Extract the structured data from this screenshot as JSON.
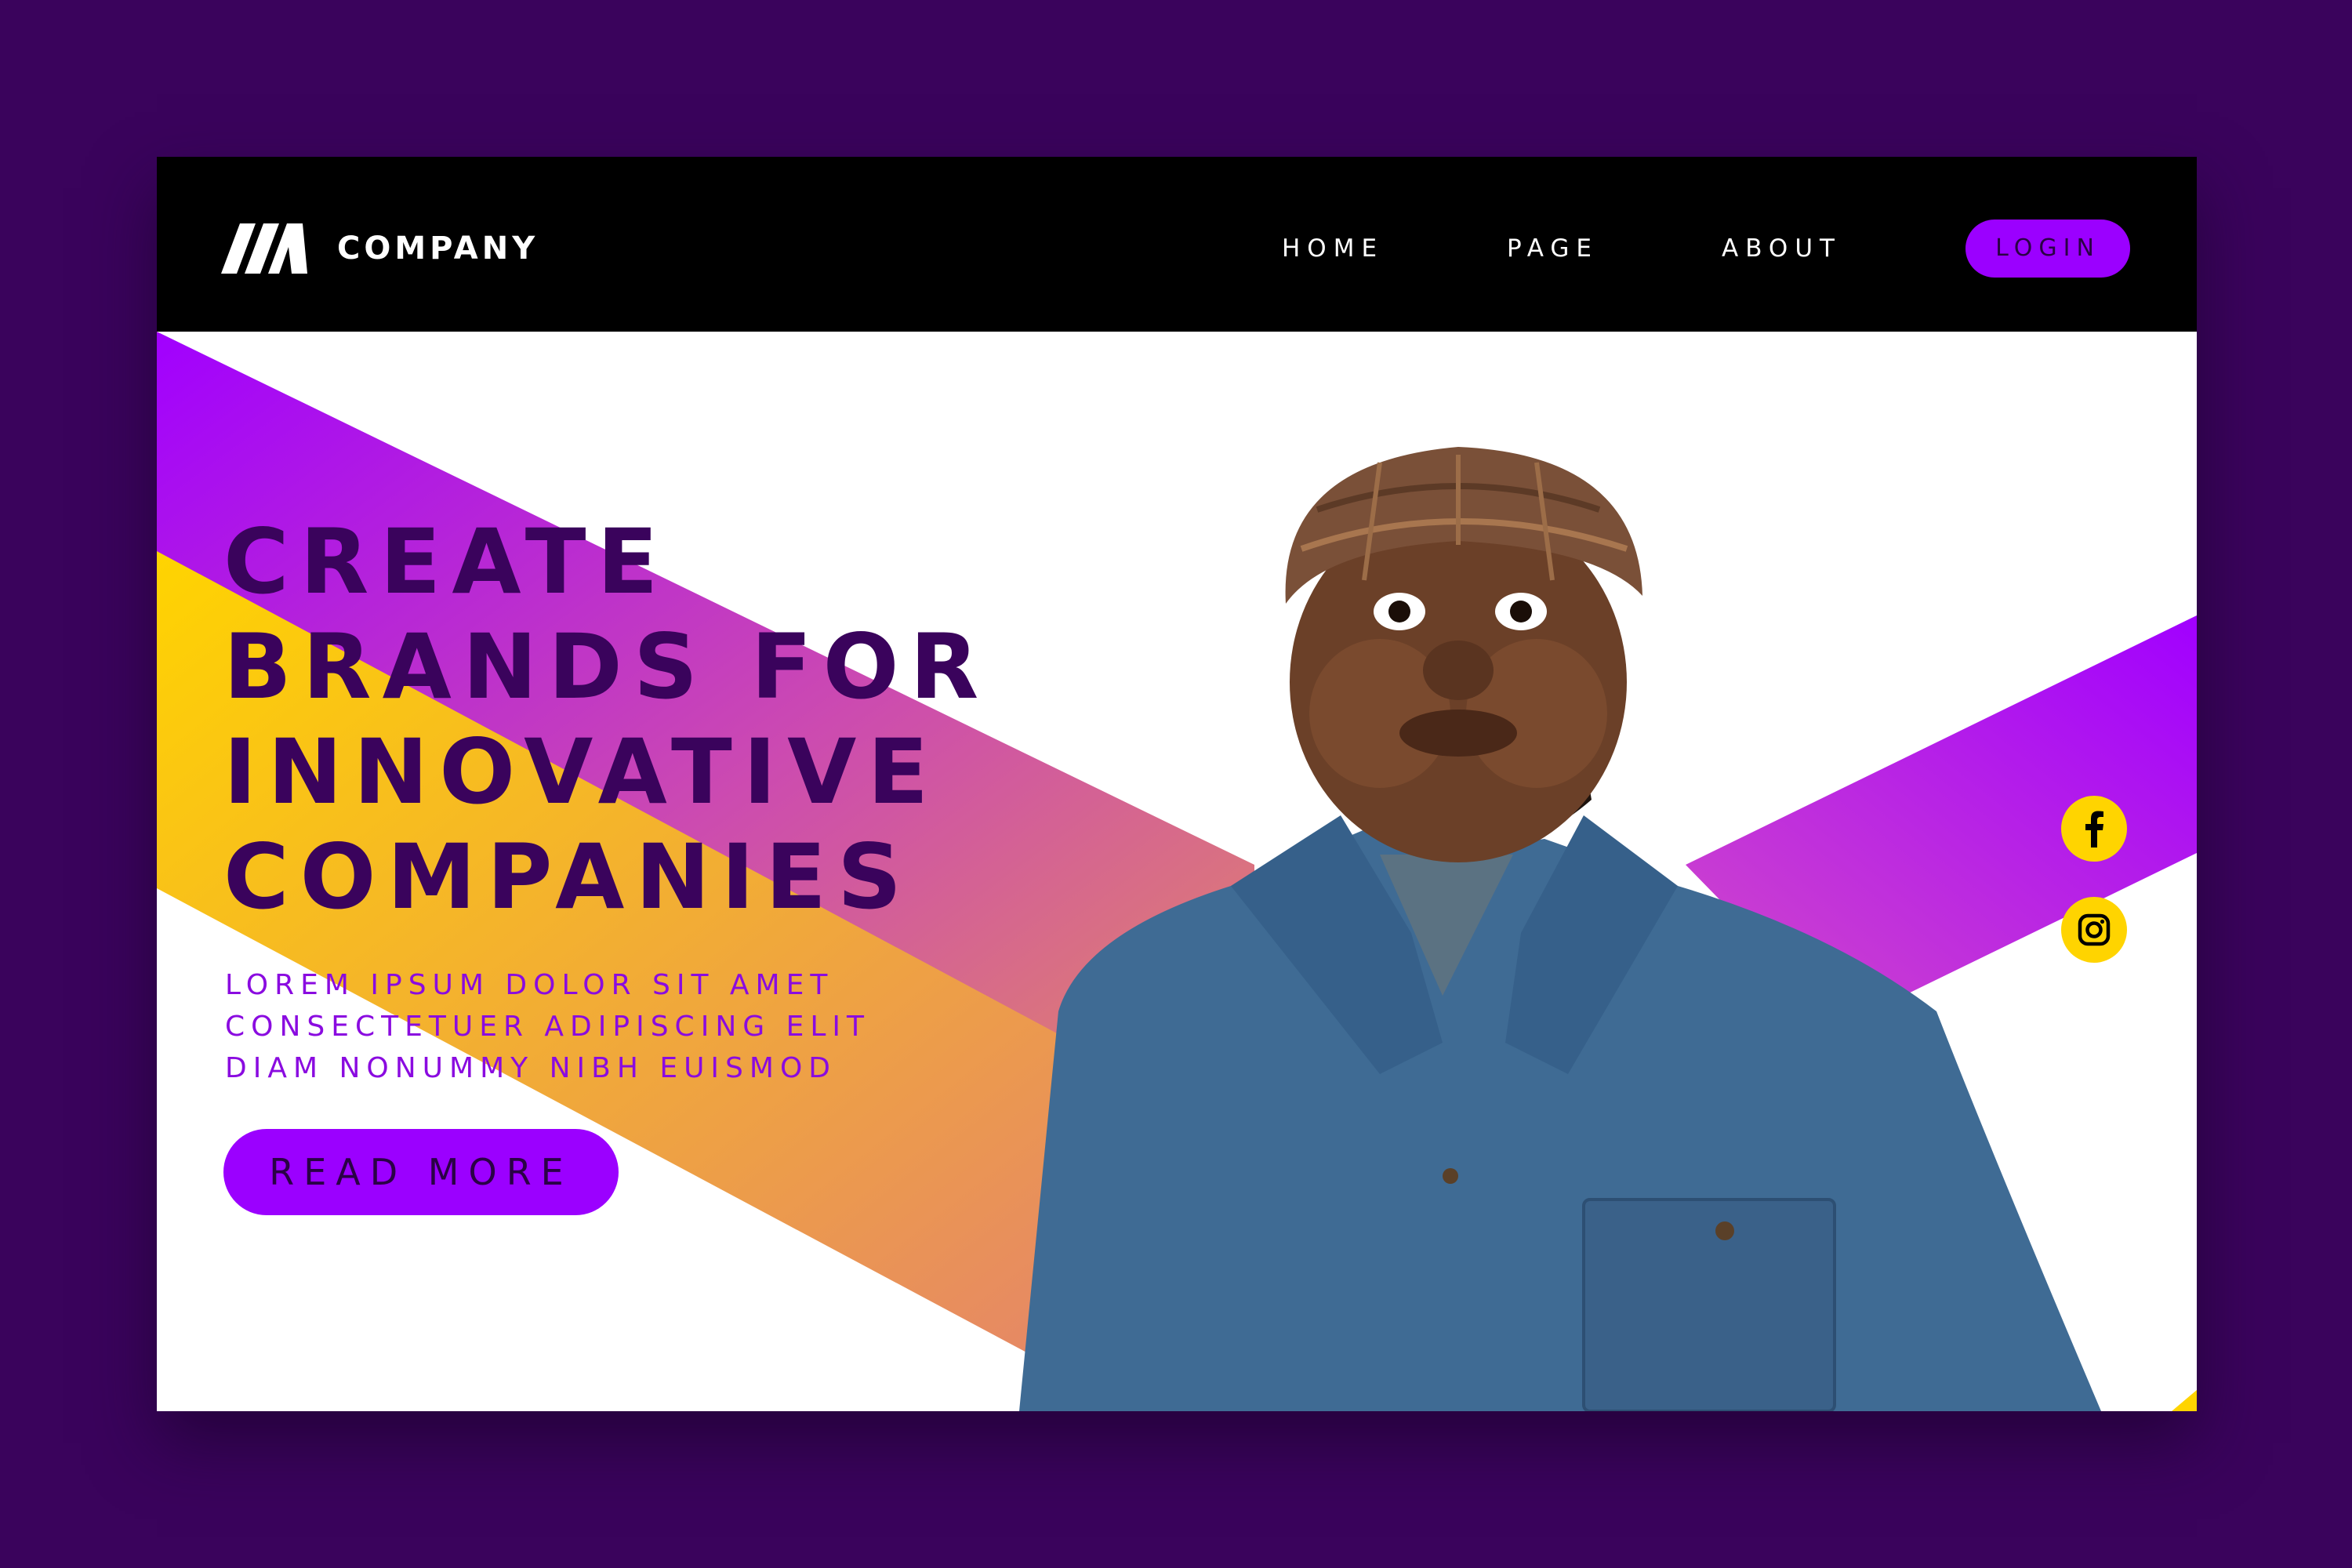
{
  "colors": {
    "page_background": "#3a035c",
    "navbar": "#000000",
    "accent_purple": "#9b00ff",
    "accent_yellow": "#ffd400",
    "headline": "#3a035c",
    "subtext": "#8a0be0"
  },
  "header": {
    "logo_icon": "stylized-m-logo-icon",
    "brand": "COMPANY",
    "nav": {
      "home": "HOME",
      "page": "PAGE",
      "about": "ABOUT"
    },
    "login": "LOGIN"
  },
  "hero": {
    "headline": [
      "CREATE",
      "BRANDS FOR",
      "INNOVATIVE",
      "COMPANIES"
    ],
    "subtext": [
      "LOREM IPSUM DOLOR SIT AMET",
      "CONSECTETUER ADIPISCING ELIT",
      "DIAM NONUMMY NIBH EUISMOD"
    ],
    "cta": "READ MORE",
    "image": "man-in-flat-cap-puffing-cheeks"
  },
  "social": [
    {
      "icon": "facebook-icon"
    },
    {
      "icon": "instagram-icon"
    }
  ]
}
